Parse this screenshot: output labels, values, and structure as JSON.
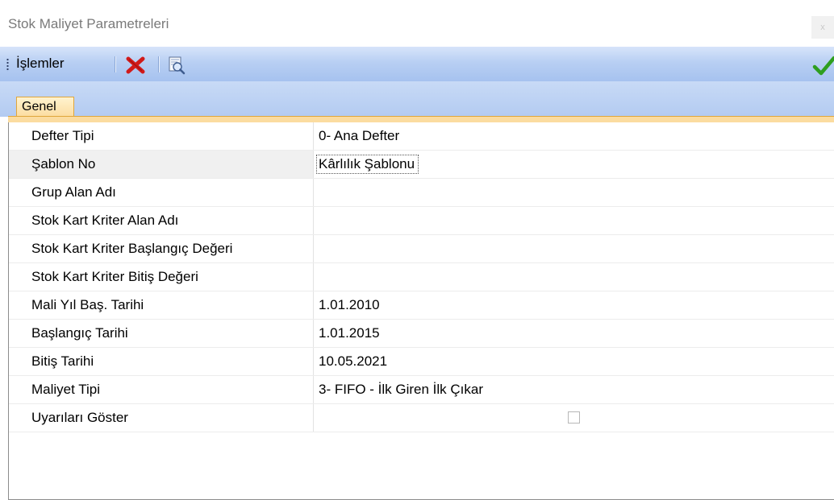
{
  "window": {
    "title": "Stok Maliyet Parametreleri",
    "close_label": "x"
  },
  "toolbar": {
    "menu_label": "İşlemler",
    "delete_icon": "red-x-icon",
    "preview_icon": "print-preview-icon",
    "ok_icon": "green-checkmark-icon"
  },
  "tabs": [
    {
      "label": "Genel",
      "active": true
    }
  ],
  "properties": [
    {
      "label": "Defter Tipi",
      "value": "0- Ana Defter"
    },
    {
      "label": "Şablon No",
      "value": "Kârlılık Şablonu",
      "selected": true
    },
    {
      "label": "Grup Alan Adı",
      "value": ""
    },
    {
      "label": "Stok Kart Kriter Alan Adı",
      "value": ""
    },
    {
      "label": "Stok Kart Kriter Başlangıç Değeri",
      "value": ""
    },
    {
      "label": "Stok Kart Kriter Bitiş Değeri",
      "value": ""
    },
    {
      "label": "Mali Yıl Baş. Tarihi",
      "value": "1.01.2010"
    },
    {
      "label": "Başlangıç Tarihi",
      "value": "1.01.2015"
    },
    {
      "label": "Bitiş Tarihi",
      "value": "10.05.2021"
    },
    {
      "label": "Maliyet Tipi",
      "value": "3- FIFO - İlk Giren İlk Çıkar"
    },
    {
      "label": "Uyarıları Göster",
      "value": "",
      "checkbox": true,
      "checked": false
    }
  ],
  "colors": {
    "toolbar_top": "#d7e4fa",
    "toolbar_bottom": "#a6c2ef",
    "tab_active": "#fbdca0",
    "tab_border": "#e0a63b",
    "delete_red": "#d11a1a",
    "ok_green": "#2e9e1f"
  }
}
